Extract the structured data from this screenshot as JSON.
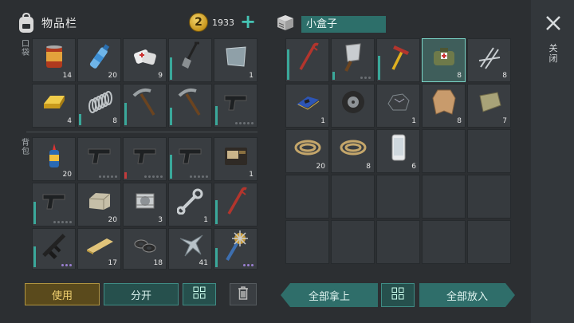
{
  "inventory": {
    "title": "物品栏",
    "coins": "1933",
    "add_label": "+",
    "pocket_label": "口袋",
    "backpack_label": "背包",
    "pocket_slots": [
      {
        "icon": "can-icon",
        "qty": "14"
      },
      {
        "icon": "water-bottle-icon",
        "qty": "20"
      },
      {
        "icon": "bandage-icon",
        "qty": "9"
      },
      {
        "icon": "shovel-icon",
        "qty": ""
      },
      {
        "icon": "metal-plate-icon",
        "qty": "1"
      },
      {
        "icon": "gold-bar-icon",
        "qty": "4"
      },
      {
        "icon": "spring-icon",
        "qty": "8"
      },
      {
        "icon": "pickaxe-icon",
        "qty": ""
      },
      {
        "icon": "pickaxe-icon",
        "qty": ""
      },
      {
        "icon": "pistol-icon",
        "qty": ""
      }
    ],
    "backpack_slots": [
      {
        "icon": "glue-icon",
        "qty": "20"
      },
      {
        "icon": "pistol-icon",
        "qty": ""
      },
      {
        "icon": "pistol-icon",
        "qty": ""
      },
      {
        "icon": "pistol-icon",
        "qty": ""
      },
      {
        "icon": "wallet-icon",
        "qty": "1"
      },
      {
        "icon": "pistol-icon",
        "qty": ""
      },
      {
        "icon": "stone-block-icon",
        "qty": "20"
      },
      {
        "icon": "engine-part-icon",
        "qty": "3"
      },
      {
        "icon": "wrench-icon",
        "qty": "1"
      },
      {
        "icon": "crowbar-icon",
        "qty": ""
      },
      {
        "icon": "rifle-icon",
        "qty": ""
      },
      {
        "icon": "wood-plank-icon",
        "qty": "17"
      },
      {
        "icon": "washers-icon",
        "qty": "18"
      },
      {
        "icon": "scrap-metal-icon",
        "qty": "41"
      },
      {
        "icon": "spiked-club-icon",
        "qty": ""
      }
    ]
  },
  "container": {
    "title": "小盒子",
    "slots": [
      {
        "icon": "crowbar-icon",
        "qty": ""
      },
      {
        "icon": "cleaver-icon",
        "qty": ""
      },
      {
        "icon": "hammer-icon",
        "qty": ""
      },
      {
        "icon": "first-aid-kit-icon",
        "qty": "8"
      },
      {
        "icon": "nails-icon",
        "qty": "8"
      },
      {
        "icon": "circuit-board-icon",
        "qty": "1"
      },
      {
        "icon": "tire-icon",
        "qty": ""
      },
      {
        "icon": "ore-icon",
        "qty": "1"
      },
      {
        "icon": "leather-icon",
        "qty": "8"
      },
      {
        "icon": "cloth-icon",
        "qty": "7"
      },
      {
        "icon": "rope-icon",
        "qty": "20"
      },
      {
        "icon": "rope-icon",
        "qty": "8"
      },
      {
        "icon": "phone-icon",
        "qty": "6"
      }
    ]
  },
  "buttons": {
    "use": "使用",
    "split": "分开",
    "take_all": "全部拿上",
    "put_all": "全部放入",
    "close": "关闭"
  },
  "colors": {
    "accent": "#2f6e6a",
    "use_button": "#5a4a1c",
    "coin": "#e0b23a"
  }
}
